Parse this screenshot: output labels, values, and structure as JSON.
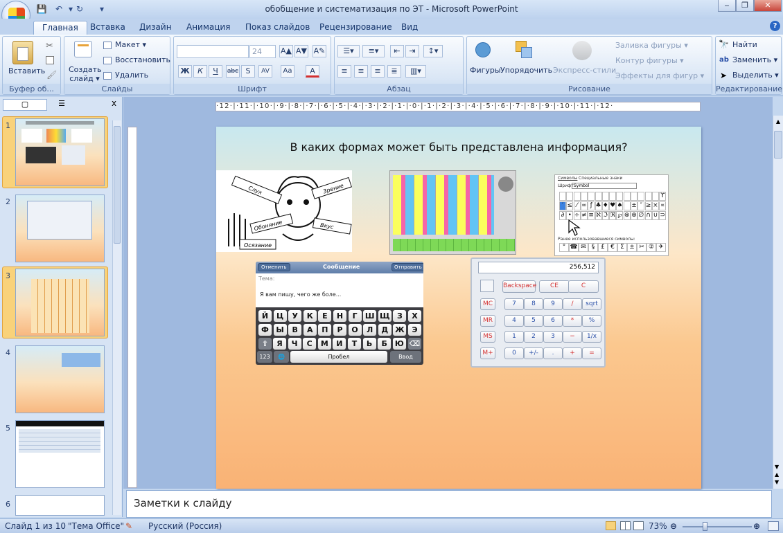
{
  "window": {
    "title": "обобщение и систематизация по ЭТ - Microsoft PowerPoint",
    "minimize": "‒",
    "restore": "❐",
    "close": "✕"
  },
  "qat": {
    "save": "💾",
    "undo": "↶",
    "redo": "↻",
    "more": "▾"
  },
  "tabs": [
    "Главная",
    "Вставка",
    "Дизайн",
    "Анимация",
    "Показ слайдов",
    "Рецензирование",
    "Вид"
  ],
  "ribbon": {
    "clipboard": {
      "label": "Буфер об...",
      "paste": "Вставить"
    },
    "slides": {
      "label": "Слайды",
      "new_slide": "Создать слайд ▾",
      "layout": "Макет ▾",
      "reset": "Восстановить",
      "delete": "Удалить"
    },
    "font": {
      "label": "Шрифт",
      "font_name": "",
      "font_size": "24",
      "bold": "Ж",
      "italic": "К",
      "underline": "Ч",
      "strike": "abc",
      "shadow": "S",
      "spacing": "AV",
      "case": "Aa",
      "color": "A",
      "grow": "A▲",
      "shrink": "A▼",
      "clear": "A✎"
    },
    "paragraph": {
      "label": "Абзац"
    },
    "drawing": {
      "label": "Рисование",
      "shapes": "Фигуры",
      "arrange": "Упорядочить",
      "quick_styles": "Экспресс-стили",
      "fill": "Заливка фигуры ▾",
      "outline": "Контур фигуры ▾",
      "effects": "Эффекты для фигур ▾"
    },
    "editing": {
      "label": "Редактирование",
      "find": "Найти",
      "replace": "Заменить ▾",
      "select": "Выделить ▾"
    }
  },
  "left_pane": {
    "tab_slides": "▢",
    "tab_outline": "☰",
    "close": "x",
    "slide_numbers": [
      "1",
      "2",
      "3",
      "4",
      "5",
      "6"
    ]
  },
  "ruler_text": "·12·|·11·|·10·|·9·|·8·|·7·|·6·|·5·|·4·|·3·|·2·|·1·|·0·|·1·|·2·|·3·|·4·|·5·|·6·|·7·|·8·|·9·|·10·|·11·|·12·",
  "slide": {
    "title": "В каких формах может быть представлена информация?",
    "senses": [
      "Слух",
      "Зрение",
      "Обоняние",
      "Вкус",
      "Осязание"
    ],
    "sms": {
      "cancel": "Отменить",
      "header": "Сообщение",
      "send": "Отправить",
      "subject": "Тема:",
      "body": "Я вам пишу, чего же боле...",
      "row1": [
        "Й",
        "Ц",
        "У",
        "К",
        "Е",
        "Н",
        "Г",
        "Ш",
        "Щ",
        "З",
        "Х"
      ],
      "row2": [
        "Ф",
        "Ы",
        "В",
        "А",
        "П",
        "Р",
        "О",
        "Л",
        "Д",
        "Ж",
        "Э"
      ],
      "row3": [
        "Я",
        "Ч",
        "С",
        "М",
        "И",
        "Т",
        "Ь",
        "Б",
        "Ю"
      ],
      "num": "123",
      "space": "Пробел",
      "enter": "Ввод"
    },
    "calc": {
      "display": "256,512",
      "backspace": "Backspace",
      "ce": "CE",
      "c": "C",
      "rows": [
        [
          "MC",
          "7",
          "8",
          "9",
          "/",
          "sqrt"
        ],
        [
          "MR",
          "4",
          "5",
          "6",
          "*",
          "%"
        ],
        [
          "MS",
          "1",
          "2",
          "3",
          "−",
          "1/x"
        ],
        [
          "M+",
          "0",
          "+/-",
          ".",
          "+",
          "="
        ]
      ]
    },
    "symbols": {
      "tab1": "Символы",
      "tab2": "Специальные знаки",
      "font_label": "Шрифт:",
      "font": "Symbol",
      "recent": "Ранее использовавшиеся символы:",
      "grid": [
        "",
        "",
        "",
        "",
        "",
        "",
        "",
        "",
        "",
        "",
        "",
        "",
        "",
        "",
        "ϒ",
        "′",
        "≤",
        "⁄",
        "∞",
        "ƒ",
        "♣",
        "♦",
        "♥",
        "♠",
        "",
        "±",
        "″",
        "≥",
        "×",
        "∝",
        "∂",
        "•",
        "÷",
        "≠",
        "≡",
        "ℵ",
        "ℑ",
        "ℜ",
        "℘",
        "⊗",
        "⊕",
        "∅",
        "∩",
        "∪",
        "⊃"
      ],
      "recent_row": [
        "°",
        "☎",
        "✉",
        "§",
        "£",
        "€",
        "Σ",
        "±",
        "✂",
        "②",
        "✈"
      ]
    }
  },
  "notes": "Заметки к слайду",
  "status": {
    "slide": "Слайд 1 из 10",
    "theme": "\"Тема Office\"",
    "lang": "Русский (Россия)",
    "zoom": "73%"
  }
}
